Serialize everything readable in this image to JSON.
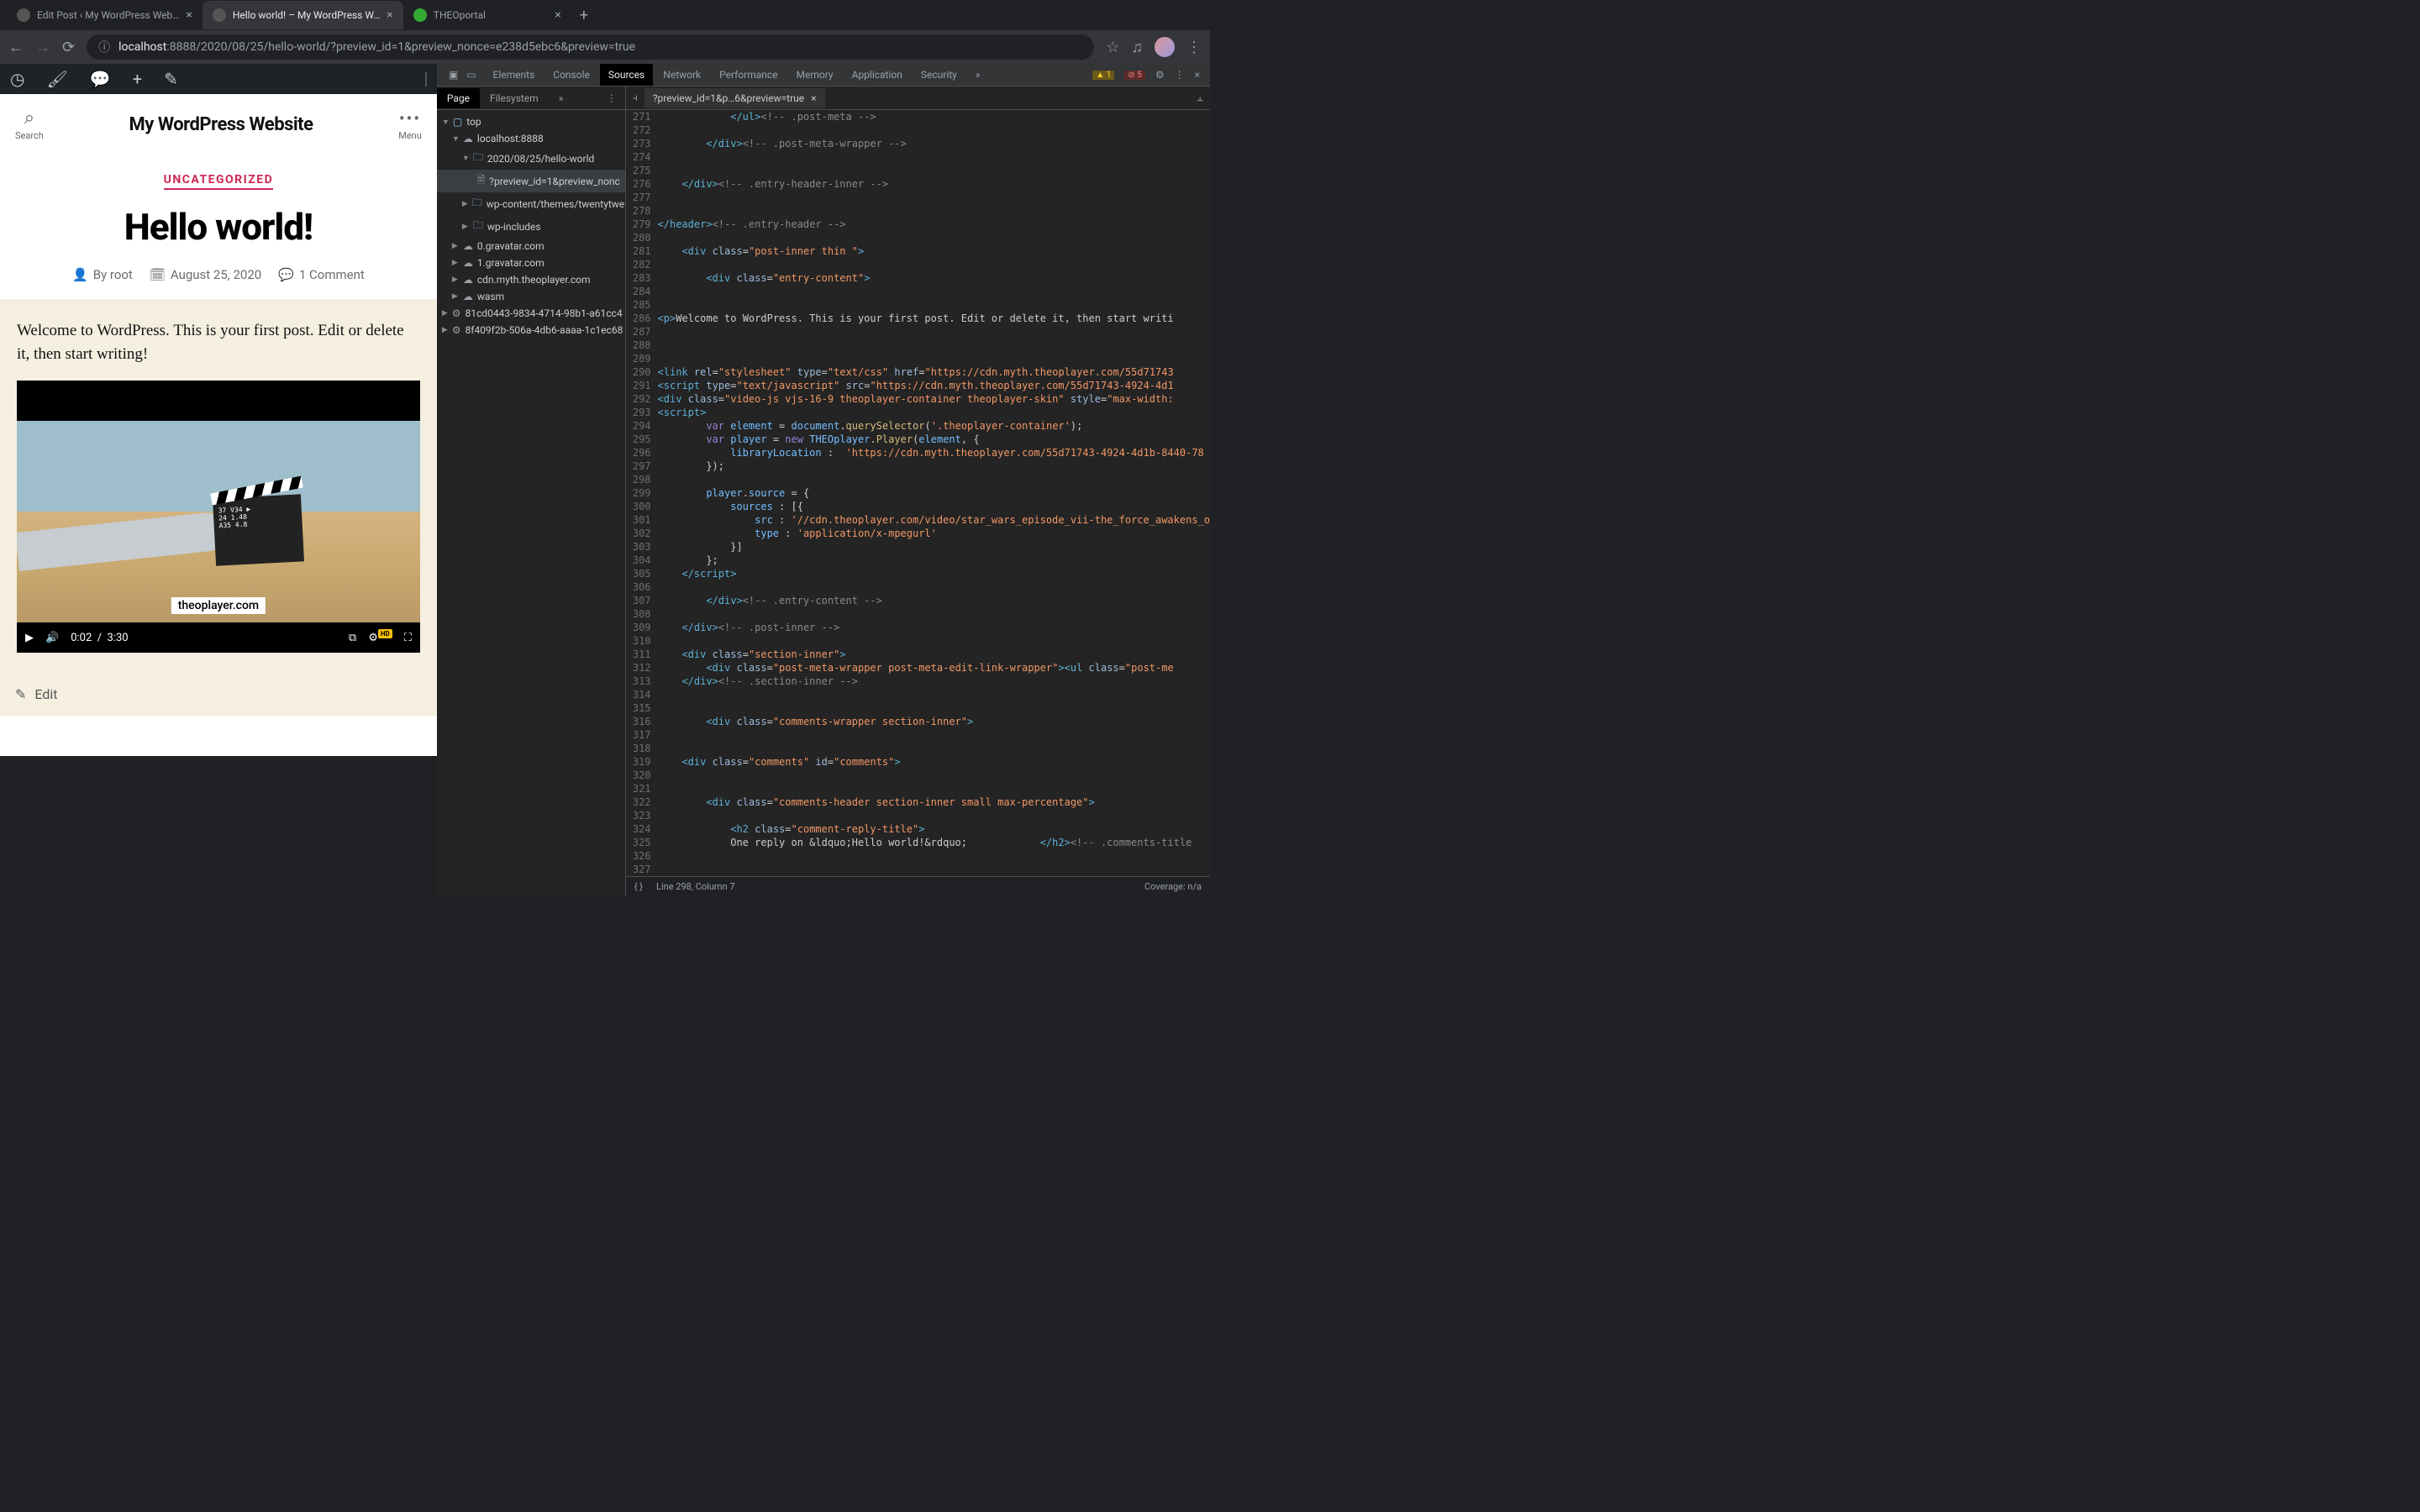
{
  "browser": {
    "tabs": [
      {
        "title": "Edit Post ‹ My WordPress Web…"
      },
      {
        "title": "Hello world! – My WordPress W…"
      },
      {
        "title": "THEOportal"
      }
    ],
    "url_host": "localhost",
    "url_port": ":8888",
    "url_path": "/2020/08/25/hello-world/?preview_id=1&preview_nonce=e238d5ebc6&preview=true"
  },
  "wp": {
    "site_title": "My WordPress Website",
    "search_label": "Search",
    "menu_label": "Menu",
    "category": "UNCATEGORIZED",
    "post_title": "Hello world!",
    "author_prefix": "By ",
    "author": "root",
    "date": "August 25, 2020",
    "comments": "1 Comment",
    "body_text": "Welcome to WordPress. This is your first post. Edit or delete it, then start writing!",
    "video_watermark": "theoplayer.com",
    "time_current": "0:02",
    "time_sep": "/",
    "time_total": "3:30",
    "hd": "HD",
    "edit_label": "Edit"
  },
  "devtools": {
    "tabs": [
      "Elements",
      "Console",
      "Sources",
      "Network",
      "Performance",
      "Memory",
      "Application",
      "Security"
    ],
    "warn_count": "1",
    "err_count": "5",
    "side_tabs": [
      "Page",
      "Filesystem"
    ],
    "tree": {
      "top": "top",
      "host": "localhost:8888",
      "path": "2020/08/25/hello-world",
      "preview": "?preview_id=1&preview_nonc",
      "wpcontent": "wp-content/themes/twentytwen",
      "wpincludes": "wp-includes",
      "g0": "0.gravatar.com",
      "g1": "1.gravatar.com",
      "cdn": "cdn.myth.theoplayer.com",
      "wasm": "wasm",
      "h1": "81cd0443-9834-4714-98b1-a61cc4",
      "h2": "8f409f2b-506a-4db6-aaaa-1c1ec68"
    },
    "editor_tab": "?preview_id=1&p…6&preview=true",
    "status_line": "Line 298, Column 7",
    "coverage": "Coverage: n/a",
    "code_lines": [
      {
        "n": 271,
        "html": "            <span class='tok-tag'>&lt;/ul&gt;</span><span class='tok-com'>&lt;!-- .post-meta --&gt;</span>"
      },
      {
        "n": 272,
        "html": ""
      },
      {
        "n": 273,
        "html": "        <span class='tok-tag'>&lt;/div&gt;</span><span class='tok-com'>&lt;!-- .post-meta-wrapper --&gt;</span>"
      },
      {
        "n": 274,
        "html": ""
      },
      {
        "n": 275,
        "html": ""
      },
      {
        "n": 276,
        "html": "    <span class='tok-tag'>&lt;/div&gt;</span><span class='tok-com'>&lt;!-- .entry-header-inner --&gt;</span>"
      },
      {
        "n": 277,
        "html": ""
      },
      {
        "n": 278,
        "html": ""
      },
      {
        "n": 279,
        "html": "<span class='tok-tag'>&lt;/header&gt;</span><span class='tok-com'>&lt;!-- .entry-header --&gt;</span>"
      },
      {
        "n": 280,
        "html": ""
      },
      {
        "n": 281,
        "html": "    <span class='tok-tag'>&lt;div</span> <span class='tok-attr'>class</span>=<span class='tok-str'>\"post-inner thin \"</span><span class='tok-tag'>&gt;</span>"
      },
      {
        "n": 282,
        "html": ""
      },
      {
        "n": 283,
        "html": "        <span class='tok-tag'>&lt;div</span> <span class='tok-attr'>class</span>=<span class='tok-str'>\"entry-content\"</span><span class='tok-tag'>&gt;</span>"
      },
      {
        "n": 284,
        "html": ""
      },
      {
        "n": 285,
        "html": ""
      },
      {
        "n": 286,
        "html": "<span class='tok-tag'>&lt;p&gt;</span>Welcome to WordPress. This is your first post. Edit or delete it, then start writi"
      },
      {
        "n": 287,
        "html": ""
      },
      {
        "n": 288,
        "html": ""
      },
      {
        "n": 289,
        "html": ""
      },
      {
        "n": 290,
        "html": "<span class='tok-tag'>&lt;link</span> <span class='tok-attr'>rel</span>=<span class='tok-str'>\"stylesheet\"</span> <span class='tok-attr'>type</span>=<span class='tok-str'>\"text/css\"</span> <span class='tok-attr'>href</span>=<span class='tok-str'>\"https://cdn.myth.theoplayer.com/55d71743</span>"
      },
      {
        "n": 291,
        "html": "<span class='tok-tag'>&lt;script</span> <span class='tok-attr'>type</span>=<span class='tok-str'>\"text/javascript\"</span> <span class='tok-attr'>src</span>=<span class='tok-str'>\"https://cdn.myth.theoplayer.com/55d71743-4924-4d1</span>"
      },
      {
        "n": 292,
        "html": "<span class='tok-tag'>&lt;div</span> <span class='tok-attr'>class</span>=<span class='tok-str'>\"video-js vjs-16-9 theoplayer-container theoplayer-skin\"</span> <span class='tok-attr'>style</span>=<span class='tok-str'>\"max-width:</span>"
      },
      {
        "n": 293,
        "html": "<span class='tok-tag'>&lt;script&gt;</span>"
      },
      {
        "n": 294,
        "html": "        <span class='tok-kw'>var</span> <span class='tok-var'>element</span> = <span class='tok-var'>document</span>.<span class='tok-fn'>querySelector</span>(<span class='tok-str'>'.theoplayer-container'</span>);"
      },
      {
        "n": 295,
        "html": "        <span class='tok-kw'>var</span> <span class='tok-var'>player</span> = <span class='tok-kw'>new</span> <span class='tok-var'>THEOplayer</span>.<span class='tok-fn'>Player</span>(<span class='tok-var'>element</span>, {"
      },
      {
        "n": 296,
        "html": "            <span class='tok-var'>libraryLocation</span> :  <span class='tok-str'>'https://cdn.myth.theoplayer.com/55d71743-4924-4d1b-8440-78</span>"
      },
      {
        "n": 297,
        "html": "        });"
      },
      {
        "n": 298,
        "html": ""
      },
      {
        "n": 299,
        "html": "        <span class='tok-var'>player</span>.<span class='tok-var'>source</span> = {"
      },
      {
        "n": 300,
        "html": "            <span class='tok-var'>sources</span> : [{"
      },
      {
        "n": 301,
        "html": "                <span class='tok-var'>src</span> : <span class='tok-str'>'//cdn.theoplayer.com/video/star_wars_episode_vii-the_force_awakens_o</span>"
      },
      {
        "n": 302,
        "html": "                <span class='tok-var'>type</span> : <span class='tok-str'>'application/x-mpegurl'</span>"
      },
      {
        "n": 303,
        "html": "            }]"
      },
      {
        "n": 304,
        "html": "        };"
      },
      {
        "n": 305,
        "html": "    <span class='tok-tag'>&lt;/script&gt;</span>"
      },
      {
        "n": 306,
        "html": ""
      },
      {
        "n": 307,
        "html": "        <span class='tok-tag'>&lt;/div&gt;</span><span class='tok-com'>&lt;!-- .entry-content --&gt;</span>"
      },
      {
        "n": 308,
        "html": ""
      },
      {
        "n": 309,
        "html": "    <span class='tok-tag'>&lt;/div&gt;</span><span class='tok-com'>&lt;!-- .post-inner --&gt;</span>"
      },
      {
        "n": 310,
        "html": ""
      },
      {
        "n": 311,
        "html": "    <span class='tok-tag'>&lt;div</span> <span class='tok-attr'>class</span>=<span class='tok-str'>\"section-inner\"</span><span class='tok-tag'>&gt;</span>"
      },
      {
        "n": 312,
        "html": "        <span class='tok-tag'>&lt;div</span> <span class='tok-attr'>class</span>=<span class='tok-str'>\"post-meta-wrapper post-meta-edit-link-wrapper\"</span><span class='tok-tag'>&gt;&lt;ul</span> <span class='tok-attr'>class</span>=<span class='tok-str'>\"post-me</span>"
      },
      {
        "n": 313,
        "html": "    <span class='tok-tag'>&lt;/div&gt;</span><span class='tok-com'>&lt;!-- .section-inner --&gt;</span>"
      },
      {
        "n": 314,
        "html": ""
      },
      {
        "n": 315,
        "html": ""
      },
      {
        "n": 316,
        "html": "        <span class='tok-tag'>&lt;div</span> <span class='tok-attr'>class</span>=<span class='tok-str'>\"comments-wrapper section-inner\"</span><span class='tok-tag'>&gt;</span>"
      },
      {
        "n": 317,
        "html": ""
      },
      {
        "n": 318,
        "html": ""
      },
      {
        "n": 319,
        "html": "    <span class='tok-tag'>&lt;div</span> <span class='tok-attr'>class</span>=<span class='tok-str'>\"comments\"</span> <span class='tok-attr'>id</span>=<span class='tok-str'>\"comments\"</span><span class='tok-tag'>&gt;</span>"
      },
      {
        "n": 320,
        "html": ""
      },
      {
        "n": 321,
        "html": ""
      },
      {
        "n": 322,
        "html": "        <span class='tok-tag'>&lt;div</span> <span class='tok-attr'>class</span>=<span class='tok-str'>\"comments-header section-inner small max-percentage\"</span><span class='tok-tag'>&gt;</span>"
      },
      {
        "n": 323,
        "html": ""
      },
      {
        "n": 324,
        "html": "            <span class='tok-tag'>&lt;h2</span> <span class='tok-attr'>class</span>=<span class='tok-str'>\"comment-reply-title\"</span><span class='tok-tag'>&gt;</span>"
      },
      {
        "n": 325,
        "html": "            One reply on &amp;ldquo;Hello world!&amp;rdquo;            <span class='tok-tag'>&lt;/h2&gt;</span><span class='tok-com'>&lt;!-- .comments-title</span>"
      },
      {
        "n": 326,
        "html": ""
      },
      {
        "n": 327,
        "html": ""
      }
    ]
  }
}
